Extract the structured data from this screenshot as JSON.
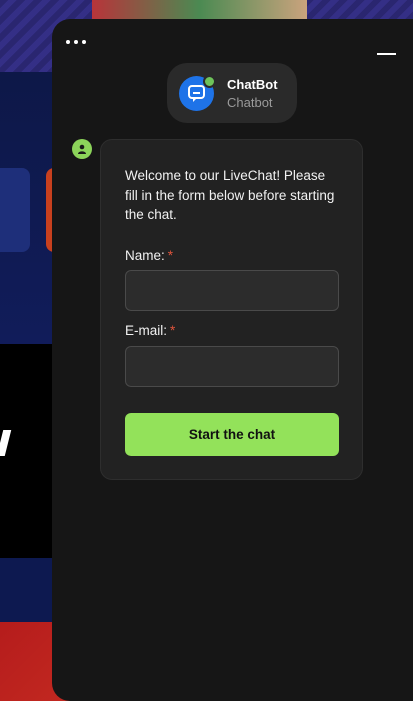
{
  "widget": {
    "agent": {
      "name": "ChatBot",
      "role": "Chatbot",
      "status": "online",
      "avatar_color": "#1e73e8",
      "status_color": "#6ec35a"
    },
    "menu_icon": "more-horizontal-icon",
    "minimize_icon": "minimize-icon",
    "message": {
      "welcome_text": "Welcome to our LiveChat! Please fill in the form below before starting the chat."
    },
    "form": {
      "name_label": "Name:",
      "name_required": "*",
      "name_value": "",
      "email_label": "E-mail:",
      "email_required": "*",
      "email_value": "",
      "submit_label": "Start the chat",
      "accent_color": "#93e25a"
    }
  }
}
